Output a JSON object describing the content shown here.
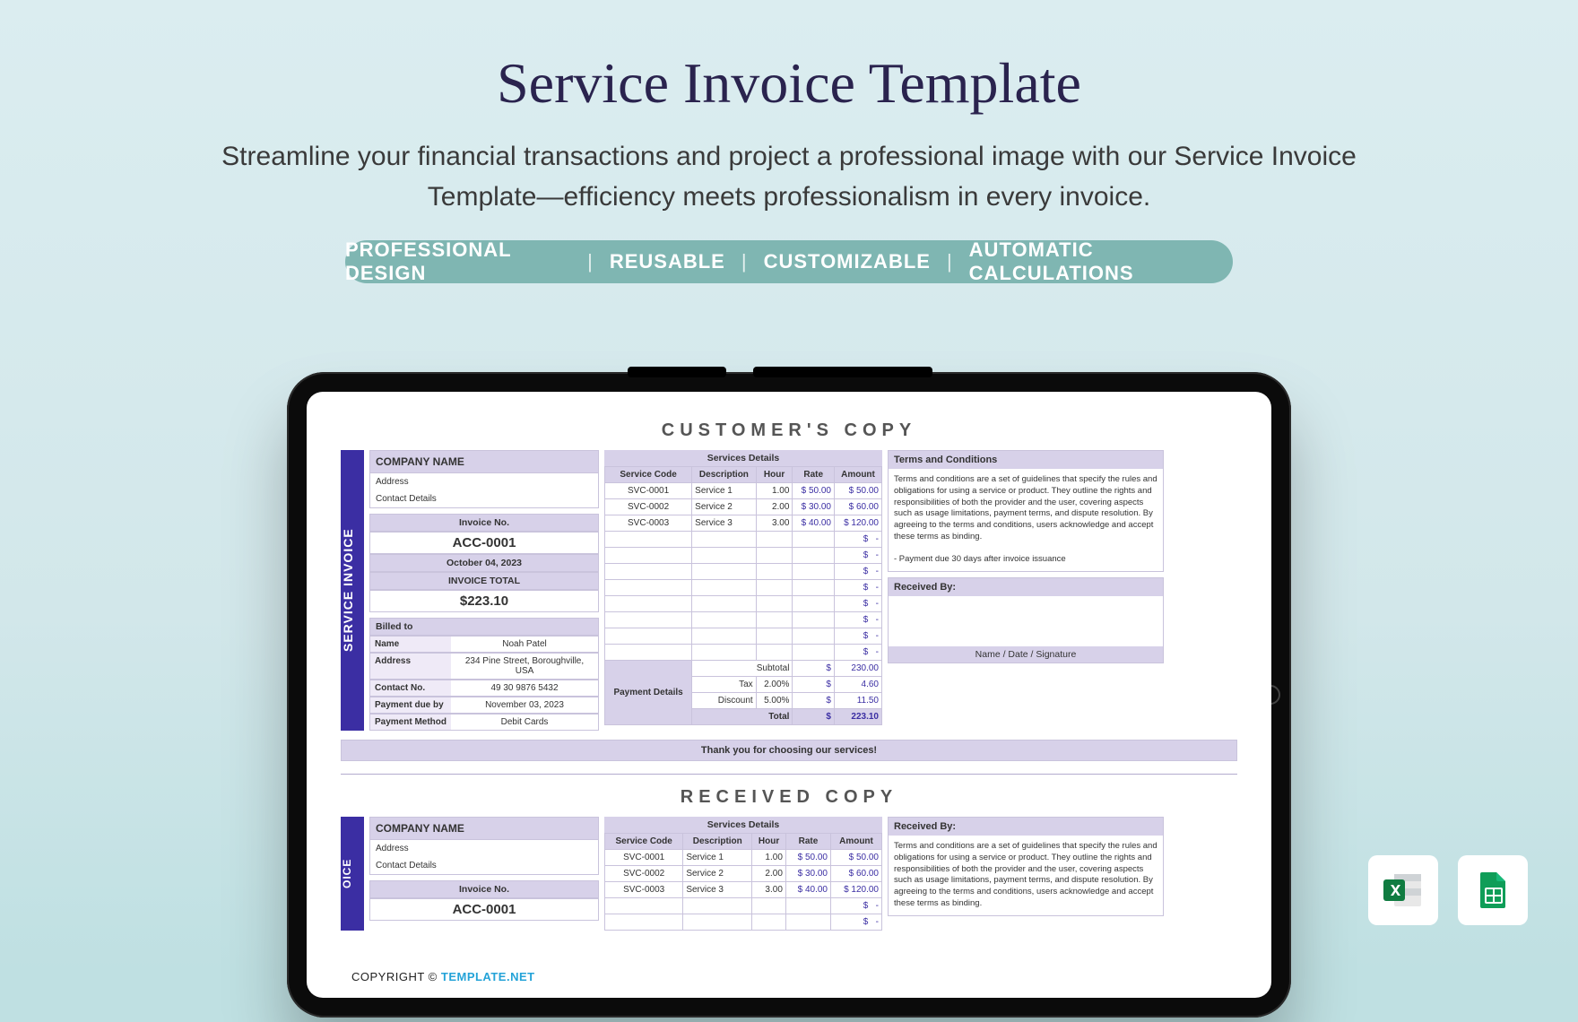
{
  "hero": {
    "title": "Service Invoice Template",
    "sub_l1": "Streamline your financial transactions and project a professional image with our Service Invoice",
    "sub_l2": "Template—efficiency meets professionalism in every invoice.",
    "b1": "PROFESSIONAL DESIGN",
    "b2": "REUSABLE",
    "b3": "CUSTOMIZABLE",
    "b4": "AUTOMATIC CALCULATIONS",
    "sep": "|"
  },
  "common": {
    "svc_head": "Services Details",
    "thcode": "Service Code",
    "thdesc": "Description",
    "thhour": "Hour",
    "thrate": "Rate",
    "thamt": "Amount",
    "company_name": "COMPANY NAME",
    "addr": "Address",
    "contact": "Contact Details",
    "invno_lbl": "Invoice No.",
    "side": "SERVICE INVOICE",
    "side2": "OICE",
    "tc": "Terms and Conditions",
    "rcv": "Received By:",
    "thanks": "Thank you for choosing our services!",
    "sig": "Name / Date / Signature"
  },
  "invoice1": {
    "title": "CUSTOMER'S COPY",
    "invno": "ACC-0001",
    "date": "October 04, 2023",
    "tot_lbl": "INVOICE TOTAL",
    "tot": "$223.10",
    "billed_lbl": "Billed to",
    "name_lbl": "Name",
    "name": "Noah Patel",
    "addr_lbl": "Address",
    "addr": "234 Pine Street, Boroughville, USA",
    "phone_lbl": "Contact No.",
    "phone": "49 30 9876 5432",
    "due_lbl": "Payment due by",
    "due": "November 03, 2023",
    "pm_lbl": "Payment Method",
    "pm": "Debit Cards",
    "rows": [
      {
        "c": "SVC-0001",
        "d": "Service 1",
        "h": "1.00",
        "r": "50.00",
        "a": "50.00"
      },
      {
        "c": "SVC-0002",
        "d": "Service 2",
        "h": "2.00",
        "r": "30.00",
        "a": "60.00"
      },
      {
        "c": "SVC-0003",
        "d": "Service 3",
        "h": "3.00",
        "r": "40.00",
        "a": "120.00"
      }
    ],
    "pay_lbl": "Payment Details",
    "sub_lbl": "Subtotal",
    "sub": "230.00",
    "tax_lbl": "Tax",
    "tax_pct": "2.00%",
    "tax": "4.60",
    "disc_lbl": "Discount",
    "disc_pct": "5.00%",
    "disc": "11.50",
    "tot2_lbl": "Total",
    "tot2": "223.10",
    "terms": "Terms and conditions are a set of guidelines that specify the rules and obligations for using a service or product. They outline the rights and responsibilities of both the provider and the user, covering aspects such as usage limitations, payment terms, and dispute resolution. By agreeing to the terms and conditions, users acknowledge and accept these terms as binding.",
    "terms2": "- Payment due 30 days after invoice issuance"
  },
  "invoice2": {
    "title": "RECEIVED COPY",
    "invno": "ACC-0001",
    "rows": [
      {
        "c": "SVC-0001",
        "d": "Service 1",
        "h": "1.00",
        "r": "50.00",
        "a": "50.00"
      },
      {
        "c": "SVC-0002",
        "d": "Service 2",
        "h": "2.00",
        "r": "30.00",
        "a": "60.00"
      },
      {
        "c": "SVC-0003",
        "d": "Service 3",
        "h": "3.00",
        "r": "40.00",
        "a": "120.00"
      }
    ],
    "terms": "Terms and conditions are a set of guidelines that specify the rules and obligations for using a service or product. They outline the rights and responsibilities of both the provider and the user, covering aspects such as usage limitations, payment terms, and dispute resolution. By agreeing to the terms and conditions, users acknowledge and accept these terms as binding."
  },
  "footer": {
    "copy": "COPYRIGHT  ©",
    "brand": "TEMPLATE.NET"
  },
  "chart_data": {
    "type": "table",
    "title": "Service Invoice Template — CUSTOMER'S COPY",
    "company": {
      "name": "COMPANY NAME",
      "address": "Address",
      "contact": "Contact Details"
    },
    "invoice": {
      "number": "ACC-0001",
      "date": "October 04, 2023",
      "total": 223.1
    },
    "billed_to": {
      "name": "Noah Patel",
      "address": "234 Pine Street, Boroughville, USA",
      "contact_no": "49 30 9876 5432",
      "payment_due_by": "November 03, 2023",
      "payment_method": "Debit Cards"
    },
    "services": [
      {
        "code": "SVC-0001",
        "description": "Service 1",
        "hour": 1.0,
        "rate": 50.0,
        "amount": 50.0
      },
      {
        "code": "SVC-0002",
        "description": "Service 2",
        "hour": 2.0,
        "rate": 30.0,
        "amount": 60.0
      },
      {
        "code": "SVC-0003",
        "description": "Service 3",
        "hour": 3.0,
        "rate": 40.0,
        "amount": 120.0
      }
    ],
    "summary": {
      "subtotal": 230.0,
      "tax_pct": 2.0,
      "tax": 4.6,
      "discount_pct": 5.0,
      "discount": 11.5,
      "total": 223.1
    }
  }
}
